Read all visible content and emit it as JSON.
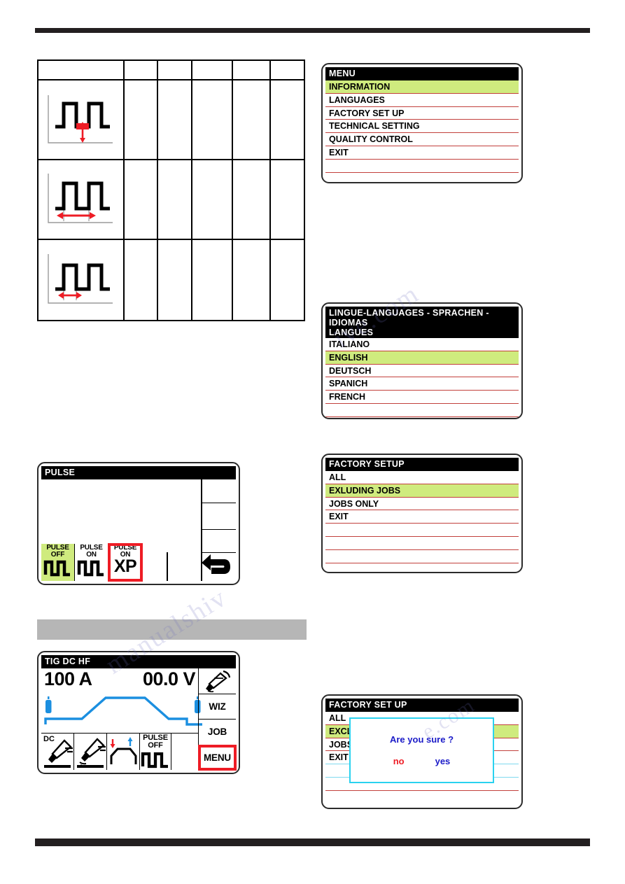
{
  "colors": {
    "highlight_green": "#cfeb7e",
    "rule_black": "#231f20",
    "separator_red": "#c2403c",
    "dialog_border_cyan": "#2ad2ef",
    "accent_red": "#ee1c25",
    "accent_blue": "#1b1bc8",
    "waveform_blue": "#1b8fe0",
    "gray_bar": "#b6b6b6"
  },
  "watermark": {
    "line_a": "ive.com",
    "line_b": "manualshiv",
    "line_c": "e.com"
  },
  "param_table": {
    "columns": 6,
    "rows": [
      {
        "icon": "pulse-base-current-icon",
        "label": ""
      },
      {
        "icon": "pulse-period-icon",
        "label": ""
      },
      {
        "icon": "pulse-width-icon",
        "label": ""
      }
    ]
  },
  "panel_menu": {
    "title": "MENU",
    "items": [
      {
        "label": "INFORMATION",
        "selected": true
      },
      {
        "label": "LANGUAGES",
        "selected": false
      },
      {
        "label": "FACTORY SET UP",
        "selected": false
      },
      {
        "label": "TECHNICAL SETTING",
        "selected": false
      },
      {
        "label": "QUALITY CONTROL",
        "selected": false
      },
      {
        "label": "EXIT",
        "selected": false
      },
      {
        "label": "",
        "selected": false
      },
      {
        "label": "",
        "selected": false
      }
    ]
  },
  "panel_languages": {
    "title_line1": "LINGUE-LANGUAGES - SPRACHEN - IDIOMAS",
    "title_line2": "LANGUES",
    "items": [
      {
        "label": "ITALIANO",
        "selected": false
      },
      {
        "label": "ENGLISH",
        "selected": true
      },
      {
        "label": "DEUTSCH",
        "selected": false
      },
      {
        "label": "SPANICH",
        "selected": false
      },
      {
        "label": "FRENCH",
        "selected": false
      },
      {
        "label": "",
        "selected": false
      },
      {
        "label": "",
        "selected": false
      }
    ]
  },
  "panel_factory": {
    "title": "FACTORY SETUP",
    "items": [
      {
        "label": "ALL",
        "selected": false
      },
      {
        "label": "EXLUDING JOBS",
        "selected": true
      },
      {
        "label": "JOBS ONLY",
        "selected": false
      },
      {
        "label": "EXIT",
        "selected": false
      },
      {
        "label": "",
        "selected": false
      },
      {
        "label": "",
        "selected": false
      },
      {
        "label": "",
        "selected": false
      },
      {
        "label": "",
        "selected": false
      }
    ]
  },
  "panel_confirm": {
    "title": "FACTORY SET UP",
    "items": [
      {
        "label": "ALL",
        "selected": false
      },
      {
        "label": "EXCLUDING JOBS",
        "selected": true
      },
      {
        "label": "JOBS ONLY",
        "selected": false
      },
      {
        "label": "EXIT",
        "selected": false
      },
      {
        "label": "",
        "selected": false
      },
      {
        "label": "",
        "selected": false
      }
    ],
    "dialog": {
      "message": "Are you sure ?",
      "no_label": "no",
      "yes_label": "yes"
    }
  },
  "panel_pulse": {
    "title": "PULSE",
    "buttons": [
      {
        "line1": "PULSE",
        "line2": "OFF",
        "icon": "pulse-square-wave-icon",
        "selected": true,
        "highlighted": false
      },
      {
        "line1": "PULSE",
        "line2": "ON",
        "icon": "pulse-square-wave-icon",
        "selected": false,
        "highlighted": false
      },
      {
        "line1": "PULSE",
        "line2": "ON",
        "icon": "xp-text",
        "xp": "XP",
        "selected": false,
        "highlighted": true
      }
    ],
    "back_icon": "back-arrow-icon"
  },
  "panel_tig": {
    "title": "TIG DC HF",
    "current_readout": "100 A",
    "voltage_readout": "00.0 V",
    "graph_icon": "weld-cycle-waveform",
    "bottom_buttons": [
      {
        "label": "DC",
        "icon": "torch-dc-icon"
      },
      {
        "label": "",
        "icon": "torch-hf-start-icon"
      },
      {
        "label": "",
        "icon": "slope-up-down-icon"
      },
      {
        "line1": "PULSE",
        "line2": "OFF",
        "icon": "pulse-square-wave-icon"
      },
      {
        "label": "",
        "icon": "empty-cell"
      }
    ],
    "right_buttons": [
      {
        "label": "",
        "icon": "torch-icon",
        "highlighted": false
      },
      {
        "label": "WIZ",
        "icon": "",
        "highlighted": false
      },
      {
        "label": "JOB",
        "icon": "",
        "highlighted": false
      },
      {
        "label": "MENU",
        "icon": "",
        "highlighted": true
      }
    ]
  }
}
